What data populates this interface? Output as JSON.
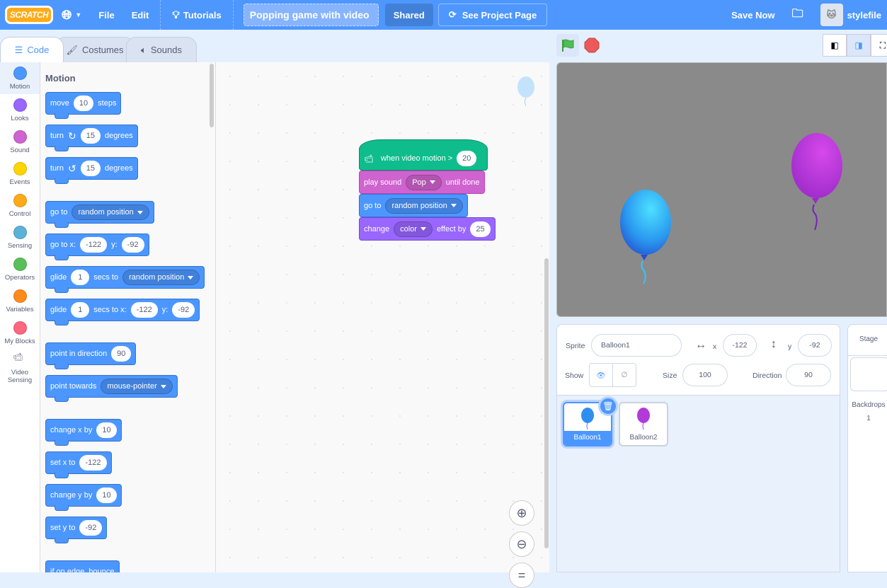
{
  "menubar": {
    "logo": "SCRATCH",
    "file": "File",
    "edit": "Edit",
    "tutorials": "Tutorials",
    "project_title": "Popping game with video",
    "shared": "Shared",
    "see_project_page": "See Project Page",
    "save_now": "Save Now",
    "username": "stylefile"
  },
  "tabs": [
    {
      "label": "Code"
    },
    {
      "label": "Costumes"
    },
    {
      "label": "Sounds"
    }
  ],
  "categories": [
    {
      "label": "Motion",
      "color": "#4c97ff"
    },
    {
      "label": "Looks",
      "color": "#9966ff"
    },
    {
      "label": "Sound",
      "color": "#cf63cf"
    },
    {
      "label": "Events",
      "color": "#ffd500"
    },
    {
      "label": "Control",
      "color": "#ffab19"
    },
    {
      "label": "Sensing",
      "color": "#5cb1d6"
    },
    {
      "label": "Operators",
      "color": "#59c059"
    },
    {
      "label": "Variables",
      "color": "#ff8c1a"
    },
    {
      "label": "My Blocks",
      "color": "#ff6680"
    },
    {
      "label": "Video Sensing",
      "color": "#0fbd8c"
    }
  ],
  "palette": {
    "heading": "Motion",
    "blocks": [
      {
        "gap": false,
        "parts": [
          [
            "t",
            "move"
          ],
          [
            "i",
            "10"
          ],
          [
            "t",
            "steps"
          ]
        ]
      },
      {
        "gap": false,
        "parts": [
          [
            "t",
            "turn"
          ],
          [
            "c",
            "↻"
          ],
          [
            "i",
            "15"
          ],
          [
            "t",
            "degrees"
          ]
        ]
      },
      {
        "gap": false,
        "parts": [
          [
            "t",
            "turn"
          ],
          [
            "c",
            "↺"
          ],
          [
            "i",
            "15"
          ],
          [
            "t",
            "degrees"
          ]
        ]
      },
      {
        "gap": true,
        "parts": [
          [
            "t",
            "go to"
          ],
          [
            "d",
            "random position"
          ]
        ]
      },
      {
        "gap": false,
        "parts": [
          [
            "t",
            "go to x:"
          ],
          [
            "i",
            "-122"
          ],
          [
            "t",
            "y:"
          ],
          [
            "i",
            "-92"
          ]
        ]
      },
      {
        "gap": false,
        "parts": [
          [
            "t",
            "glide"
          ],
          [
            "i",
            "1"
          ],
          [
            "t",
            "secs to"
          ],
          [
            "d",
            "random position"
          ]
        ]
      },
      {
        "gap": false,
        "parts": [
          [
            "t",
            "glide"
          ],
          [
            "i",
            "1"
          ],
          [
            "t",
            "secs to x:"
          ],
          [
            "i",
            "-122"
          ],
          [
            "t",
            "y:"
          ],
          [
            "i",
            "-92"
          ]
        ]
      },
      {
        "gap": true,
        "parts": [
          [
            "t",
            "point in direction"
          ],
          [
            "i",
            "90"
          ]
        ]
      },
      {
        "gap": false,
        "parts": [
          [
            "t",
            "point towards"
          ],
          [
            "d",
            "mouse-pointer"
          ]
        ]
      },
      {
        "gap": true,
        "parts": [
          [
            "t",
            "change x by"
          ],
          [
            "i",
            "10"
          ]
        ]
      },
      {
        "gap": false,
        "parts": [
          [
            "t",
            "set x to"
          ],
          [
            "i",
            "-122"
          ]
        ]
      },
      {
        "gap": false,
        "parts": [
          [
            "t",
            "change y by"
          ],
          [
            "i",
            "10"
          ]
        ]
      },
      {
        "gap": false,
        "parts": [
          [
            "t",
            "set y to"
          ],
          [
            "i",
            "-92"
          ]
        ]
      },
      {
        "gap": true,
        "parts": [
          [
            "t",
            "if on edge, bounce"
          ]
        ]
      }
    ]
  },
  "script": [
    {
      "kind": "hat",
      "color": "#0fbd8c",
      "border": "#0b8e69",
      "parts": [
        [
          "t",
          "when video motion >"
        ],
        [
          "i",
          "20"
        ]
      ]
    },
    {
      "kind": "stack",
      "color": "#cf63cf",
      "border": "#bd42bd",
      "parts": [
        [
          "t",
          "play sound"
        ],
        [
          "d",
          "Pop"
        ],
        [
          "t",
          "until done"
        ]
      ]
    },
    {
      "kind": "stack",
      "color": "#4c97ff",
      "border": "#3373cc",
      "parts": [
        [
          "t",
          "go to"
        ],
        [
          "d",
          "random position"
        ]
      ]
    },
    {
      "kind": "stack",
      "color": "#9966ff",
      "border": "#774dcb",
      "parts": [
        [
          "t",
          "change"
        ],
        [
          "d",
          "color"
        ],
        [
          "t",
          "effect by"
        ],
        [
          "i",
          "25"
        ]
      ]
    }
  ],
  "sprite_info": {
    "sprite_label": "Sprite",
    "sprite_name": "Balloon1",
    "x_label": "x",
    "x": "-122",
    "y_label": "y",
    "y": "-92",
    "show_label": "Show",
    "size_label": "Size",
    "size": "100",
    "direction_label": "Direction",
    "direction": "90"
  },
  "sprites": [
    {
      "name": "Balloon1",
      "color": "#2e8ff0"
    },
    {
      "name": "Balloon2",
      "color": "#b23ad8"
    }
  ],
  "stage_panel": {
    "title": "Stage",
    "backdrops_label": "Backdrops",
    "backdrops_count": "1"
  }
}
